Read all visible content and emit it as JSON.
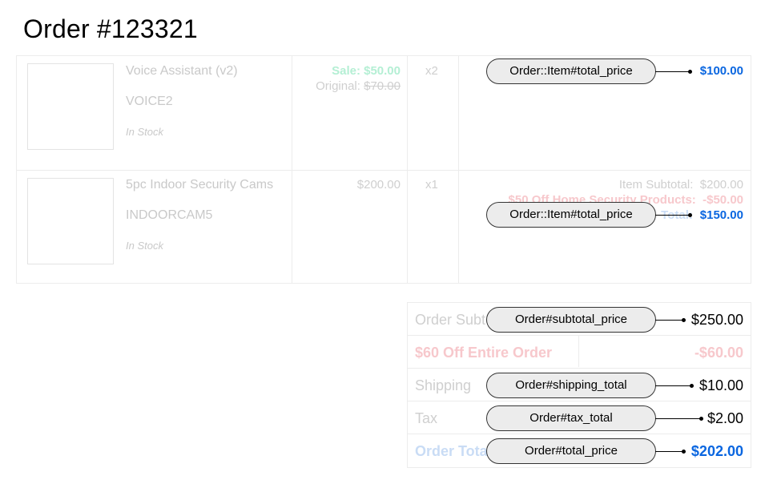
{
  "order": {
    "title": "Order #123321"
  },
  "items": [
    {
      "name": "Voice Assistant (v2)",
      "sku": "VOICE2",
      "stock": "In Stock",
      "sale_price": "Sale: $50.00",
      "original_label": "Original:",
      "original_price": "$70.00",
      "quantity": "x2",
      "total": "$100.00"
    },
    {
      "name": "5pc Indoor Security Cams",
      "sku": "INDOORCAM5",
      "stock": "In Stock",
      "price": "$200.00",
      "quantity": "x1",
      "subtotal_label": "Item Subtotal:",
      "subtotal": "$200.00",
      "discount_label": "$50 Off Home Security Products:",
      "discount": "-$50.00",
      "total_label": "Total:",
      "total": "$150.00"
    }
  ],
  "summary": {
    "subtotal_label": "Order Subtotal",
    "subtotal": "$250.00",
    "discount_label": "$60 Off Entire Order",
    "discount": "-$60.00",
    "shipping_label": "Shipping",
    "shipping": "$10.00",
    "tax_label": "Tax",
    "tax": "$2.00",
    "total_label": "Order Total",
    "total": "$202.00"
  },
  "callouts": {
    "item1": "Order::Item#total_price",
    "item2": "Order::Item#total_price",
    "subtotal": "Order#subtotal_price",
    "shipping": "Order#shipping_total",
    "tax": "Order#tax_total",
    "total": "Order#total_price"
  },
  "colors": {
    "accent_blue": "#0a66e0",
    "sale_green": "#b4efd4",
    "discount_pink": "#f7c8cc",
    "callout_fill": "#ececec"
  }
}
